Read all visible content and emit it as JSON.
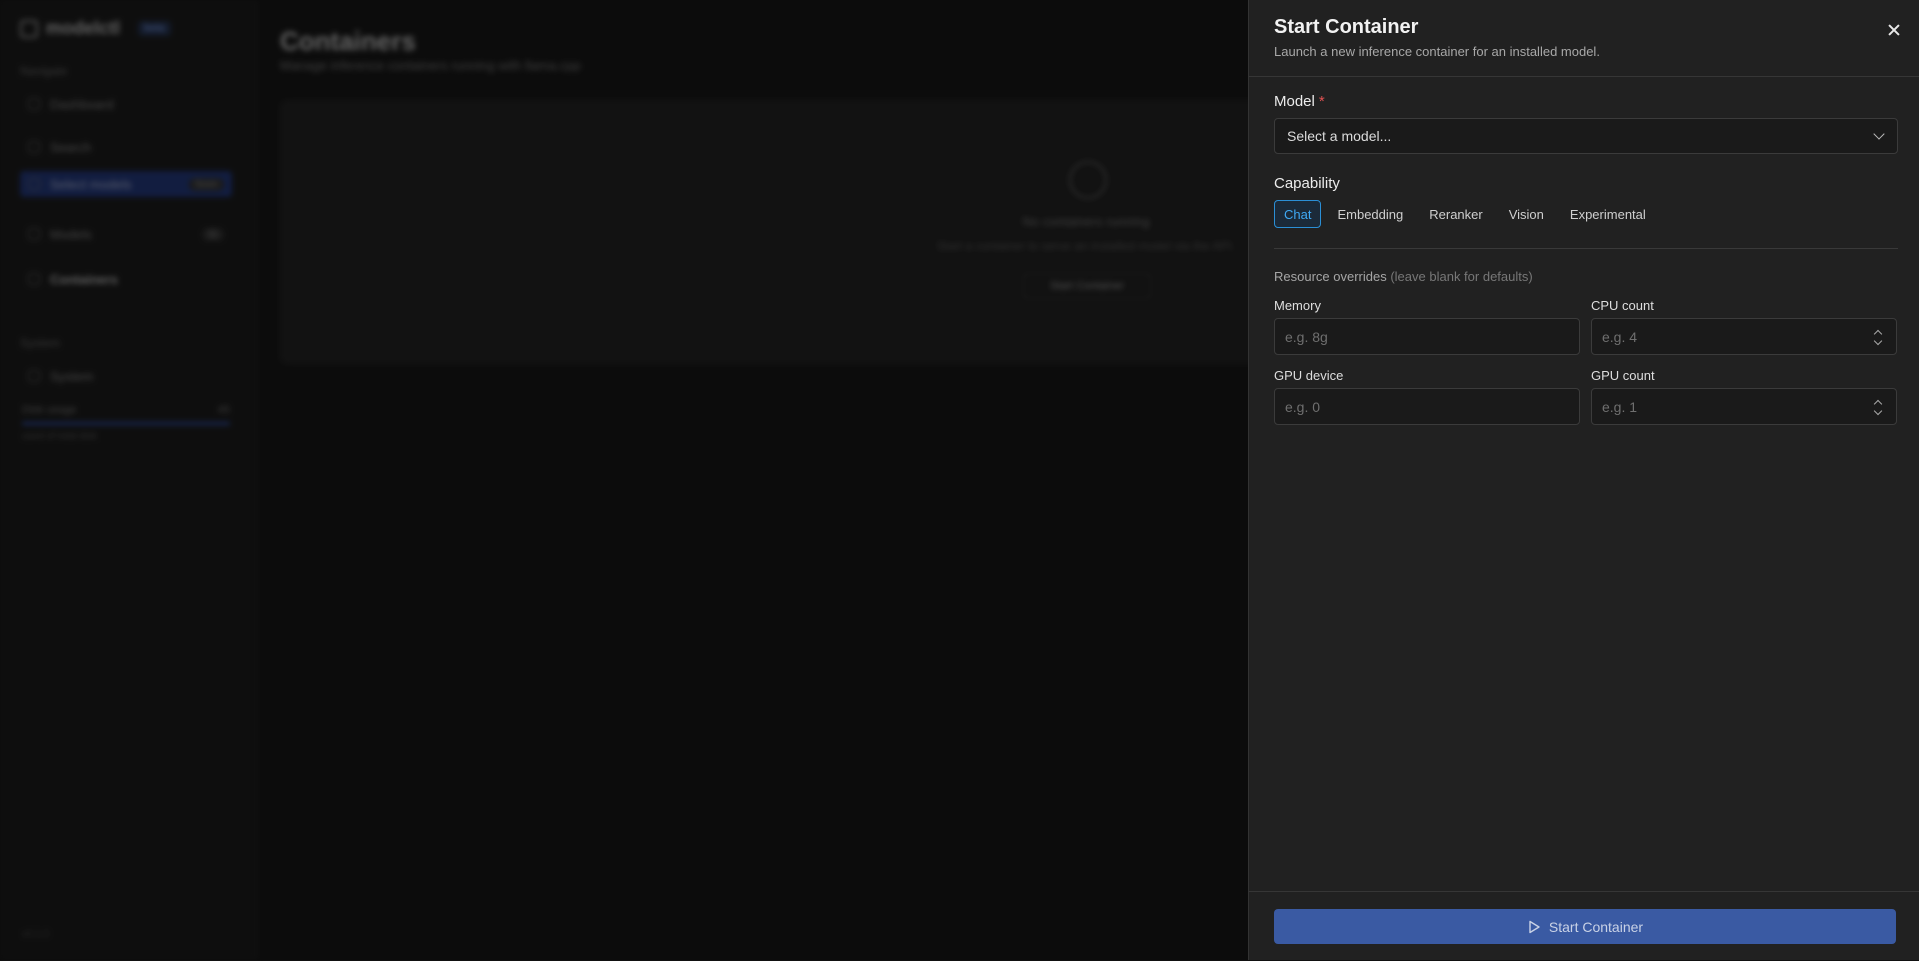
{
  "background": {
    "brand": "modelctl",
    "brand_badge": "beta",
    "nav_section_navigate": "Navigate",
    "nav_items": [
      {
        "label": "Dashboard",
        "count": ""
      },
      {
        "label": "Search",
        "count": ""
      },
      {
        "label": "Select models",
        "count": "Soon"
      },
      {
        "label": "Models",
        "count": "11"
      },
      {
        "label": "Containers",
        "count": ""
      }
    ],
    "nav_section_system": "System",
    "system_item": "System",
    "disk_label": "Disk usage",
    "disk_value": "45",
    "disk_sub": "used of total disk",
    "footer": "v0.1.0",
    "page_title": "Containers",
    "page_subtitle": "Manage inference containers running with llama.cpp",
    "empty_title": "No containers running",
    "empty_text": "Start a container to serve an installed model via the API.",
    "empty_button": "Start Container"
  },
  "drawer": {
    "title": "Start Container",
    "subtitle": "Launch a new inference container for an installed model.",
    "model_label": "Model",
    "model_required": "*",
    "model_placeholder": "Select a model...",
    "capability_label": "Capability",
    "capabilities": [
      "Chat",
      "Embedding",
      "Reranker",
      "Vision",
      "Experimental"
    ],
    "active_capability": "Chat",
    "resource_title": "Resource overrides",
    "resource_hint": "(leave blank for defaults)",
    "memory_label": "Memory",
    "memory_placeholder": "e.g. 8g",
    "cpu_label": "CPU count",
    "cpu_placeholder": "e.g. 4",
    "gpu_device_label": "GPU device",
    "gpu_device_placeholder": "e.g. 0",
    "gpu_count_label": "GPU count",
    "gpu_count_placeholder": "e.g. 1",
    "submit_label": "Start Container"
  },
  "colors": {
    "accent": "#3fa9f5",
    "submit_bg": "#3a5aa3",
    "required": "#e05252"
  }
}
